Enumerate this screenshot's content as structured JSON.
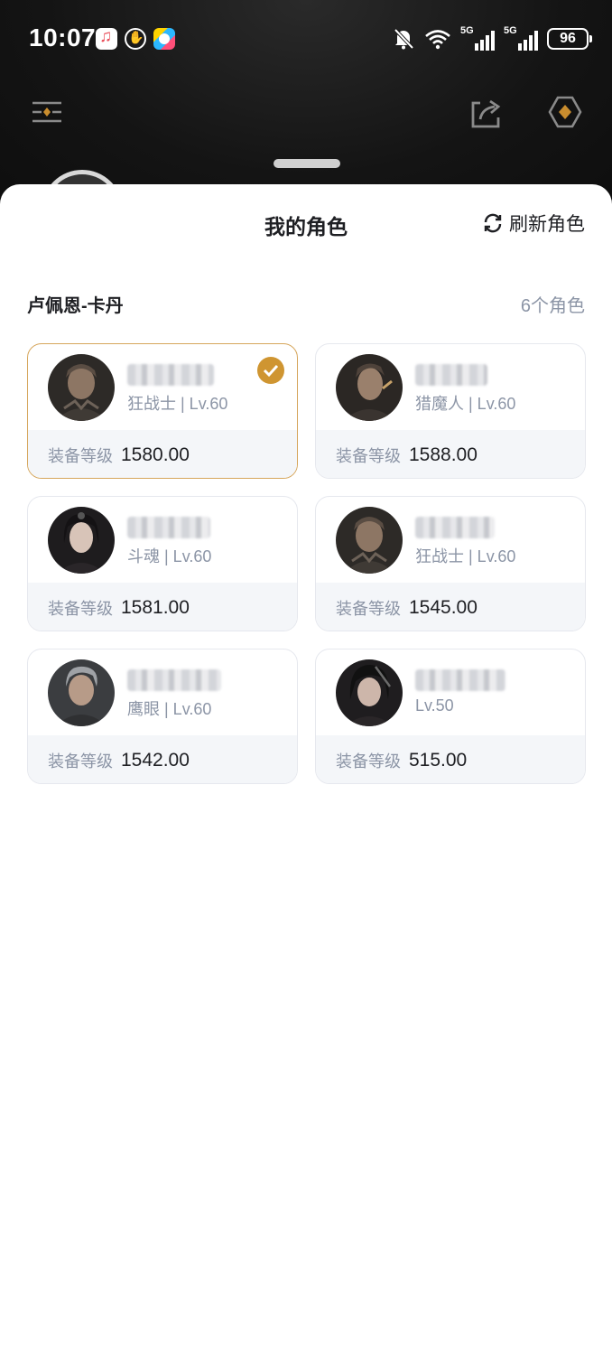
{
  "status_bar": {
    "time": "10:07",
    "signal1_label": "5G",
    "signal2_label": "5G",
    "battery": "96"
  },
  "sheet": {
    "title": "我的角色",
    "refresh_label": "刷新角色",
    "server_name": "卢佩恩-卡丹",
    "role_count": "6个角色"
  },
  "gear_label": "装备等级",
  "characters": [
    {
      "class_level": "狂战士 | Lv.60",
      "gear_score": "1580.00",
      "selected": true
    },
    {
      "class_level": "猎魔人 | Lv.60",
      "gear_score": "1588.00",
      "selected": false
    },
    {
      "class_level": "斗魂 | Lv.60",
      "gear_score": "1581.00",
      "selected": false
    },
    {
      "class_level": "狂战士 | Lv.60",
      "gear_score": "1545.00",
      "selected": false
    },
    {
      "class_level": "鹰眼 | Lv.60",
      "gear_score": "1542.00",
      "selected": false
    },
    {
      "class_level": "Lv.50",
      "gear_score": "515.00",
      "selected": false
    }
  ],
  "colors": {
    "accent": "#cf9531",
    "selected_border": "#d6a65c",
    "muted_text": "#8c95a6"
  }
}
